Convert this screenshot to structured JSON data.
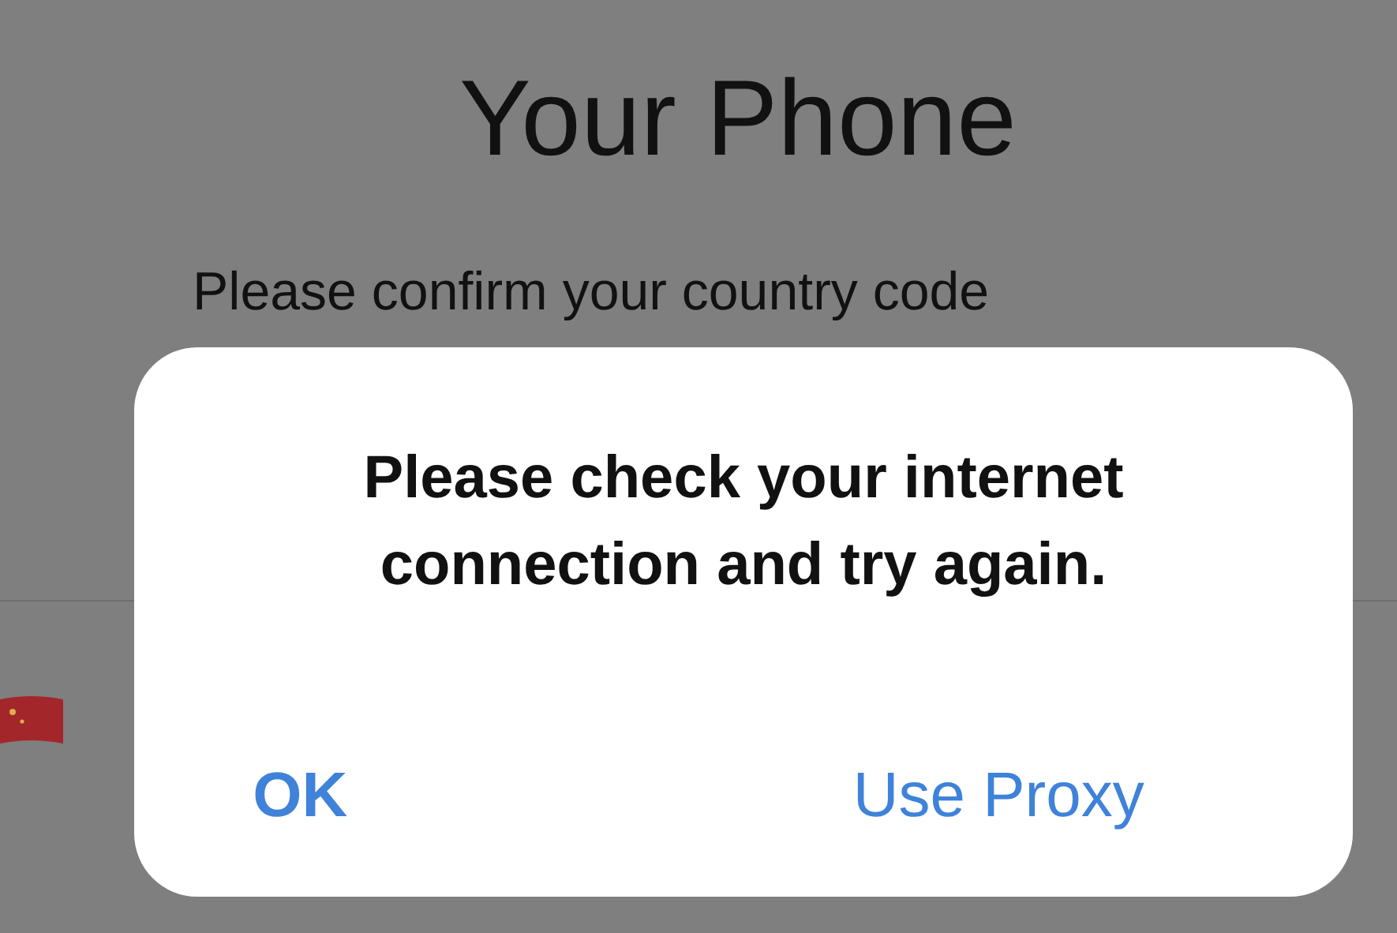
{
  "screen": {
    "title": "Your Phone",
    "subtitle": "Please confirm your country code"
  },
  "alert": {
    "message": "Please check your internet connection and try again.",
    "buttons": [
      {
        "label": "OK",
        "kind": "default"
      },
      {
        "label": "Use Proxy",
        "kind": "action"
      }
    ]
  }
}
